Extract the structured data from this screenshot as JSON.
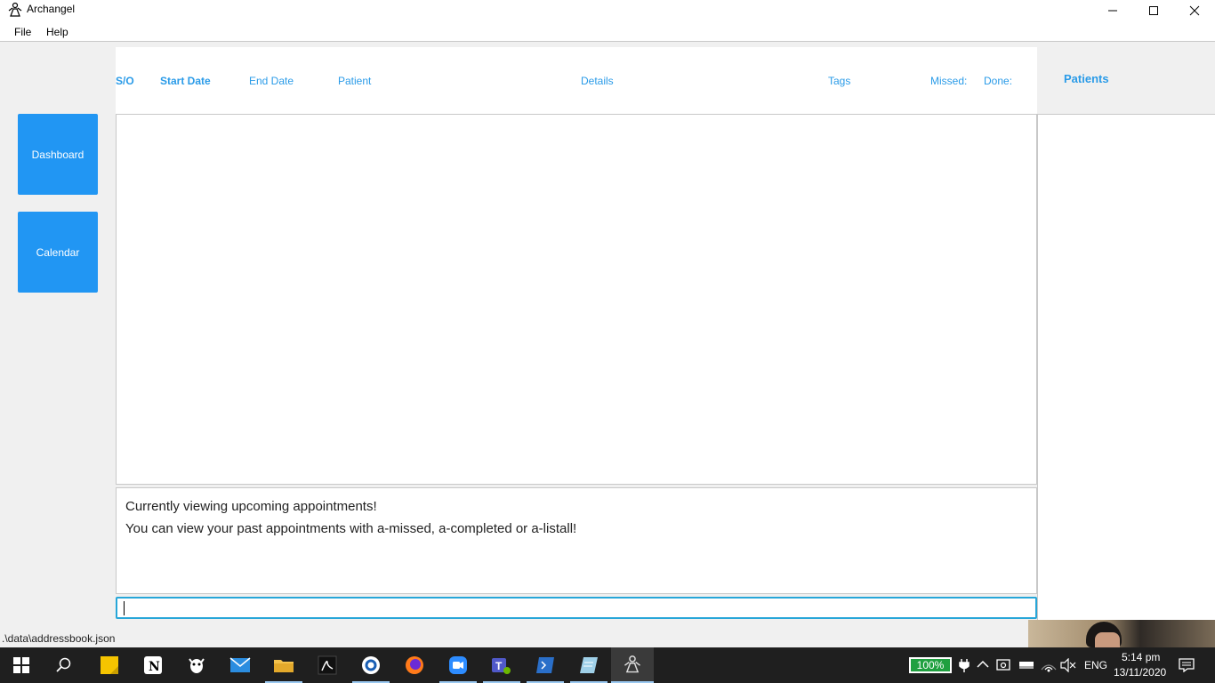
{
  "window": {
    "title": "Archangel"
  },
  "menu": {
    "file": "File",
    "help": "Help"
  },
  "nav": {
    "dashboard": "Dashboard",
    "calendar": "Calendar"
  },
  "appointments": {
    "columns": [
      "S/O",
      "Start Date",
      "End Date",
      "Patient",
      "Details",
      "Tags",
      "Missed:",
      "Done:"
    ]
  },
  "patients": {
    "title": "Patients"
  },
  "result": {
    "line1": "Currently viewing upcoming appointments!",
    "line2": "You can view your past appointments with a-missed, a-completed or a-listall!"
  },
  "command": {
    "value": ""
  },
  "status": {
    "path": ".\\data\\addressbook.json"
  },
  "taskbar": {
    "battery": "100%",
    "language": "ENG",
    "time": "5:14 pm",
    "date": "13/11/2020"
  },
  "colors": {
    "accent": "#2196f3",
    "header_text": "#2a9be8",
    "input_border": "#27a6d8"
  }
}
